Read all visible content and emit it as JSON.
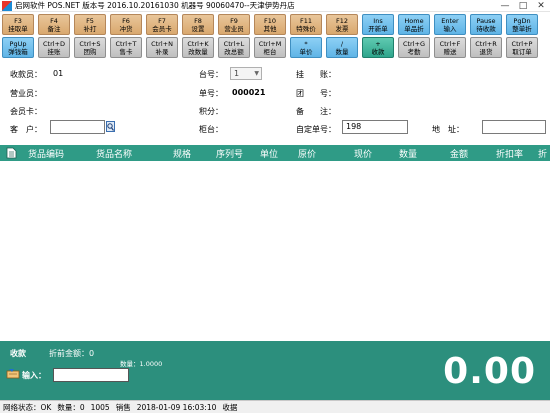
{
  "window": {
    "title": "启网软件 POS.NET 版本号 2016.10.20161030 机器号 90060470--天津伊势丹店",
    "controls": {
      "minimize": "—",
      "maximize": "□",
      "close": "✕"
    }
  },
  "toolbar": {
    "row1": [
      {
        "key": "F3",
        "label": "挂取单",
        "color": "tan"
      },
      {
        "key": "F4",
        "label": "备注",
        "color": "tan"
      },
      {
        "key": "F5",
        "label": "补打",
        "color": "tan"
      },
      {
        "key": "F6",
        "label": "冲货",
        "color": "tan"
      },
      {
        "key": "F7",
        "label": "会员卡",
        "color": "tan"
      },
      {
        "key": "F8",
        "label": "设置",
        "color": "tan"
      },
      {
        "key": "F9",
        "label": "营业员",
        "color": "tan"
      },
      {
        "key": "F10",
        "label": "其他",
        "color": "tan"
      },
      {
        "key": "F11",
        "label": "特殊价",
        "color": "tan"
      },
      {
        "key": "F12",
        "label": "发票",
        "color": "tan"
      },
      {
        "key": "Ins",
        "label": "开新单",
        "color": "blue"
      },
      {
        "key": "Home",
        "label": "单品折",
        "color": "blue"
      },
      {
        "key": "Enter",
        "label": "输入",
        "color": "blue"
      },
      {
        "key": "Pause",
        "label": "待收款",
        "color": "blue"
      },
      {
        "key": "PgDn",
        "label": "整单折",
        "color": "blue"
      }
    ],
    "row2": [
      {
        "key": "PgUp",
        "label": "弹钱箱",
        "color": "blue"
      },
      {
        "key": "Ctrl+D",
        "label": "挂账",
        "color": "gray"
      },
      {
        "key": "Ctrl+S",
        "label": "团购",
        "color": "gray"
      },
      {
        "key": "Ctrl+T",
        "label": "售卡",
        "color": "gray"
      },
      {
        "key": "Ctrl+N",
        "label": "补录",
        "color": "gray"
      },
      {
        "key": "Ctrl+K",
        "label": "改数量",
        "color": "gray"
      },
      {
        "key": "Ctrl+L",
        "label": "改总额",
        "color": "gray"
      },
      {
        "key": "Ctrl+M",
        "label": "柜台",
        "color": "gray"
      },
      {
        "key": "*",
        "label": "单价",
        "color": "blue"
      },
      {
        "key": "/",
        "label": "数量",
        "color": "blue"
      },
      {
        "key": "+",
        "label": "收款",
        "color": "teal"
      },
      {
        "key": "Ctrl+G",
        "label": "考勤",
        "color": "gray"
      },
      {
        "key": "Ctrl+F",
        "label": "赠送",
        "color": "gray"
      },
      {
        "key": "Ctrl+R",
        "label": "退货",
        "color": "gray"
      },
      {
        "key": "Ctrl+P",
        "label": "取订单",
        "color": "gray"
      }
    ]
  },
  "info": {
    "cashier_label": "收款员：",
    "cashier_value": "01",
    "clerk_label": "营业员：",
    "member_label": "会员卡：",
    "customer_label": "客　户：",
    "customer_value": "",
    "register_label": "台号：",
    "register_value": "1",
    "order_no_label": "单号：",
    "order_no_value": "000021",
    "points_label": "积分：",
    "counter_label": "柜台：",
    "suspend_label": "挂　　账：",
    "group_label": "团　　号：",
    "remark_label": "备　　注：",
    "custom_no_label": "自定单号：",
    "custom_no_value": "198",
    "address_label": "地　址：",
    "address_value": ""
  },
  "table": {
    "columns": [
      "货品编码",
      "货品名称",
      "规格",
      "序列号",
      "单位",
      "原价",
      "现价",
      "数量",
      "金额",
      "折扣率",
      "折"
    ]
  },
  "summary": {
    "receive_label": "收款",
    "discount_label": "折前金额：0",
    "quantity_label": "数量：1.0000",
    "input_label": "输入：",
    "input_value": "",
    "total": "0.00"
  },
  "status": {
    "network": "网络状态：OK",
    "qty": "数量：0",
    "code": "1005",
    "mode": "销售",
    "datetime": "2018-01-09 16:03:10",
    "receipt": "收据"
  },
  "colors": {
    "header_teal": "#2f9b86",
    "panel_teal": "#2c8f7d",
    "button_tan": "#d9a86e",
    "button_blue": "#5fb4e6"
  }
}
